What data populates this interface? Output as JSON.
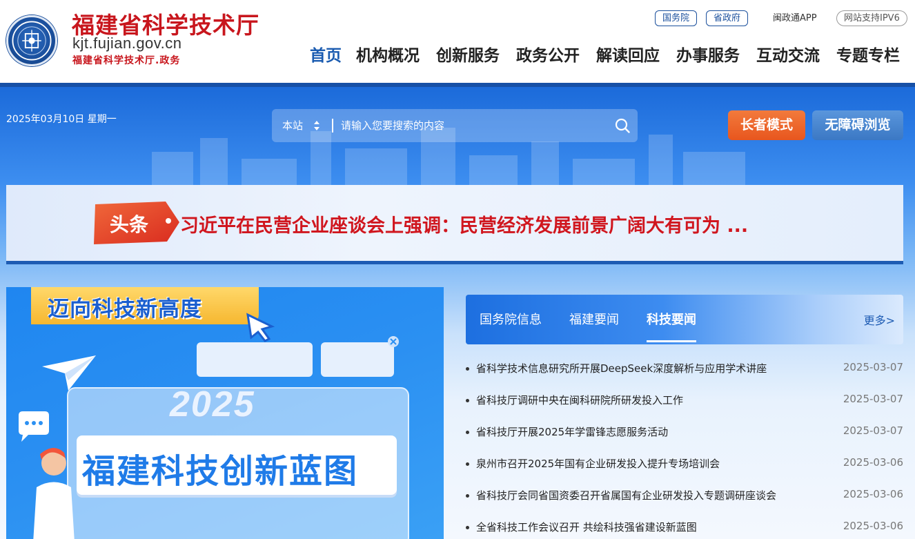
{
  "header": {
    "site_title": "福建省科学技术厅",
    "site_domain": "kjt.fujian.gov.cn",
    "site_subtitle": "福建省科学技术厅.政务",
    "top_links": {
      "state_council": "国务院",
      "provincial_gov": "省政府",
      "app": "闽政通APP",
      "ipv6": "网站支持IPV6"
    },
    "nav": [
      {
        "label": "首页",
        "active": true
      },
      {
        "label": "机构概况",
        "active": false
      },
      {
        "label": "创新服务",
        "active": false
      },
      {
        "label": "政务公开",
        "active": false
      },
      {
        "label": "解读回应",
        "active": false
      },
      {
        "label": "办事服务",
        "active": false
      },
      {
        "label": "互动交流",
        "active": false
      },
      {
        "label": "专题专栏",
        "active": false
      }
    ]
  },
  "toolbar": {
    "date": "2025年03月10日 星期一",
    "search_scope": "本站",
    "search_placeholder": "请输入您要搜索的内容",
    "elder_mode": "长者模式",
    "accessible_browse": "无障碍浏览"
  },
  "headline": {
    "tag": "头条",
    "text": "习近平在民营企业座谈会上强调：民营经济发展前景广阔大有可为 ..."
  },
  "feature": {
    "heading": "迈向科技新高度",
    "year": "2025",
    "title": "福建科技创新蓝图"
  },
  "news": {
    "tabs": [
      {
        "label": "国务院信息",
        "active": false
      },
      {
        "label": "福建要闻",
        "active": false
      },
      {
        "label": "科技要闻",
        "active": true
      }
    ],
    "more": "更多>",
    "items": [
      {
        "title": "省科学技术信息研究所开展DeepSeek深度解析与应用学术讲座",
        "date": "2025-03-07"
      },
      {
        "title": "省科技厅调研中央在闽科研院所研发投入工作",
        "date": "2025-03-07"
      },
      {
        "title": "省科技厅开展2025年学雷锋志愿服务活动",
        "date": "2025-03-07"
      },
      {
        "title": "泉州市召开2025年国有企业研发投入提升专场培训会",
        "date": "2025-03-06"
      },
      {
        "title": "省科技厅会同省国资委召开省属国有企业研发投入专题调研座谈会",
        "date": "2025-03-06"
      },
      {
        "title": "全省科技工作会议召开 共绘科技强省建设新蓝图",
        "date": "2025-03-06"
      }
    ]
  },
  "colors": {
    "brand_red": "#c8161d",
    "nav_active": "#1a5bb0",
    "elder_button": "#e8561e",
    "access_button": "#3b78c4"
  }
}
